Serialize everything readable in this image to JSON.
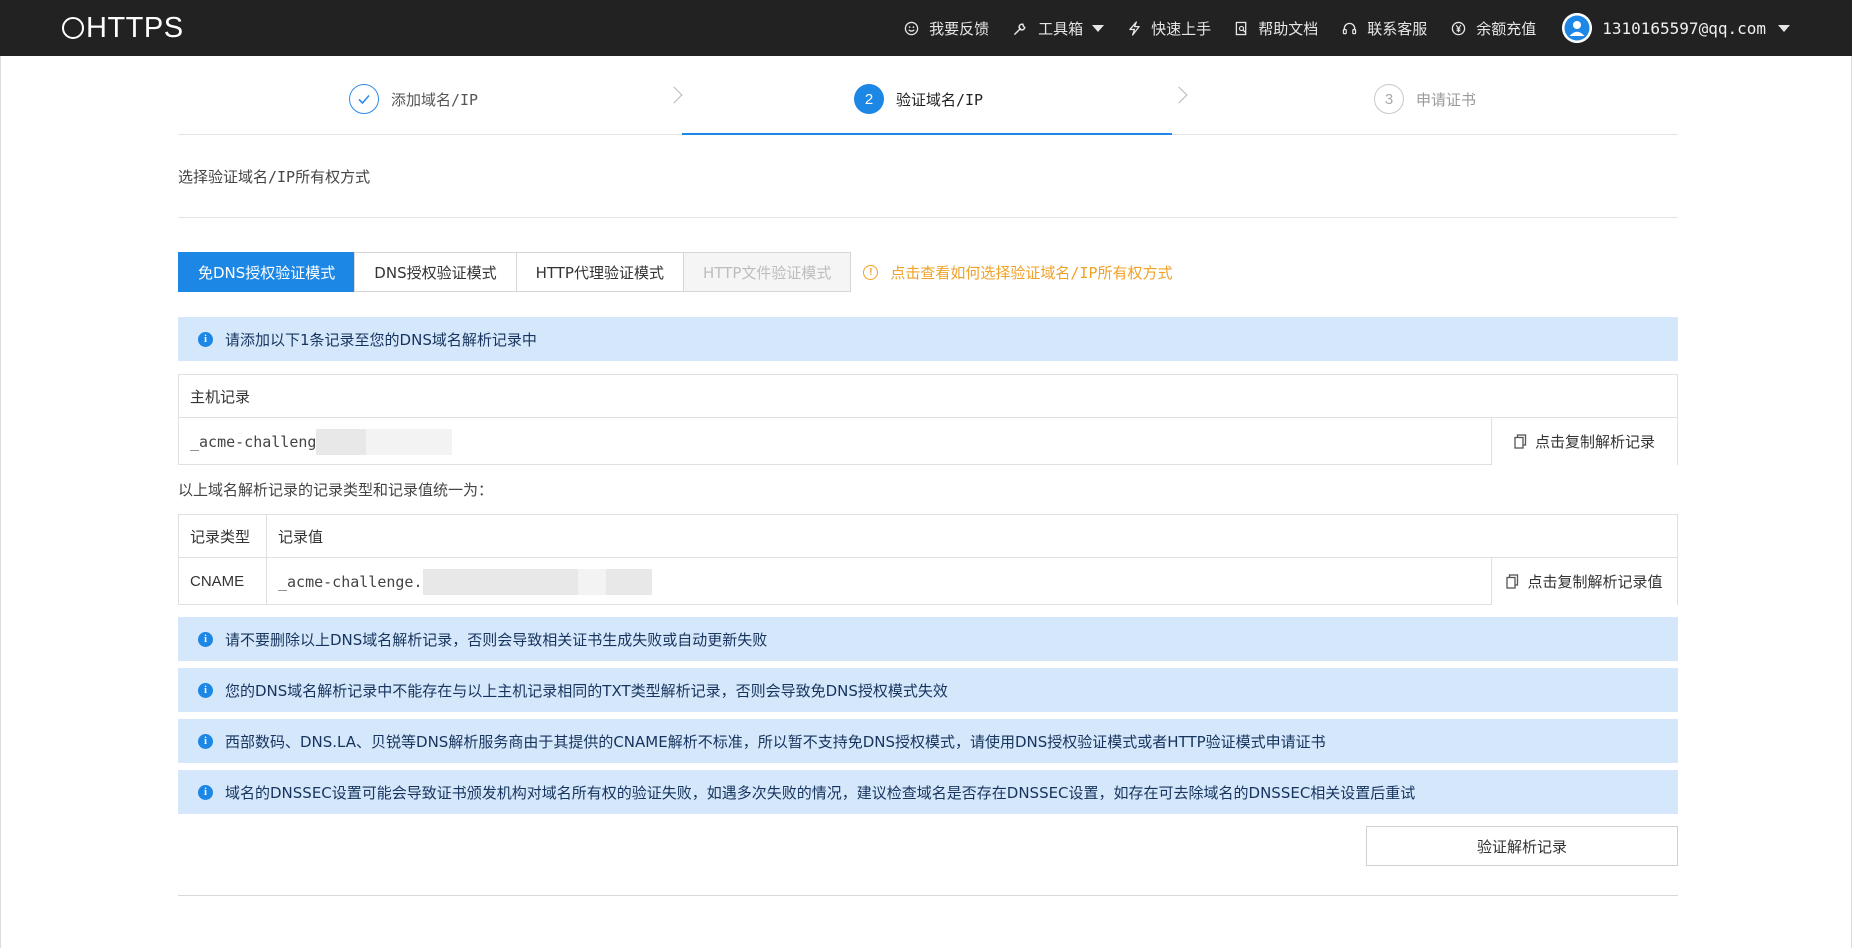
{
  "header": {
    "logo_text": "HTTPS",
    "nav": [
      {
        "label": "我要反馈",
        "icon": "smile-icon"
      },
      {
        "label": "工具箱",
        "icon": "wrench-icon"
      },
      {
        "label": "快速上手",
        "icon": "bolt-icon"
      },
      {
        "label": "帮助文档",
        "icon": "document-icon"
      },
      {
        "label": "联系客服",
        "icon": "headset-icon"
      },
      {
        "label": "余额充值",
        "icon": "yen-circle-icon"
      }
    ],
    "user_email": "1310165597@qq.com"
  },
  "steps": [
    {
      "number": "✓",
      "label": "添加域名/IP",
      "state": "done"
    },
    {
      "number": "2",
      "label": "验证域名/IP",
      "state": "active"
    },
    {
      "number": "3",
      "label": "申请证书",
      "state": "todo"
    }
  ],
  "section_title": "选择验证域名/IP所有权方式",
  "tabs": [
    {
      "label": "免DNS授权验证模式",
      "state": "active"
    },
    {
      "label": "DNS授权验证模式",
      "state": "normal"
    },
    {
      "label": "HTTP代理验证模式",
      "state": "normal"
    },
    {
      "label": "HTTP文件验证模式",
      "state": "disabled"
    }
  ],
  "help_link": "点击查看如何选择验证域名/IP所有权方式",
  "info_top": "请添加以下1条记录至您的DNS域名解析记录中",
  "host_table": {
    "header": "主机记录",
    "value": "_acme-challeng",
    "copy_label": "点击复制解析记录"
  },
  "record_note": "以上域名解析记录的记录类型和记录值统一为：",
  "record_table": {
    "header_type": "记录类型",
    "header_value": "记录值",
    "type": "CNAME",
    "value": "_acme-challenge.",
    "copy_label": "点击复制解析记录值"
  },
  "notices": [
    "请不要删除以上DNS域名解析记录，否则会导致相关证书生成失败或自动更新失败",
    "您的DNS域名解析记录中不能存在与以上主机记录相同的TXT类型解析记录，否则会导致免DNS授权模式失效",
    "西部数码、DNS.LA、贝锐等DNS解析服务商由于其提供的CNAME解析不标准，所以暂不支持免DNS授权模式，请使用DNS授权验证模式或者HTTP验证模式申请证书",
    "域名的DNSSEC设置可能会导致证书颁发机构对域名所有权的验证失败，如遇多次失败的情况，建议检查域名是否存在DNSSEC设置，如存在可去除域名的DNSSEC相关设置后重试"
  ],
  "verify_button": "验证解析记录",
  "colors": {
    "accent": "#1d87e5",
    "topbar": "#222222",
    "info_bg": "#d5e7fb",
    "warning": "#f0a127"
  }
}
